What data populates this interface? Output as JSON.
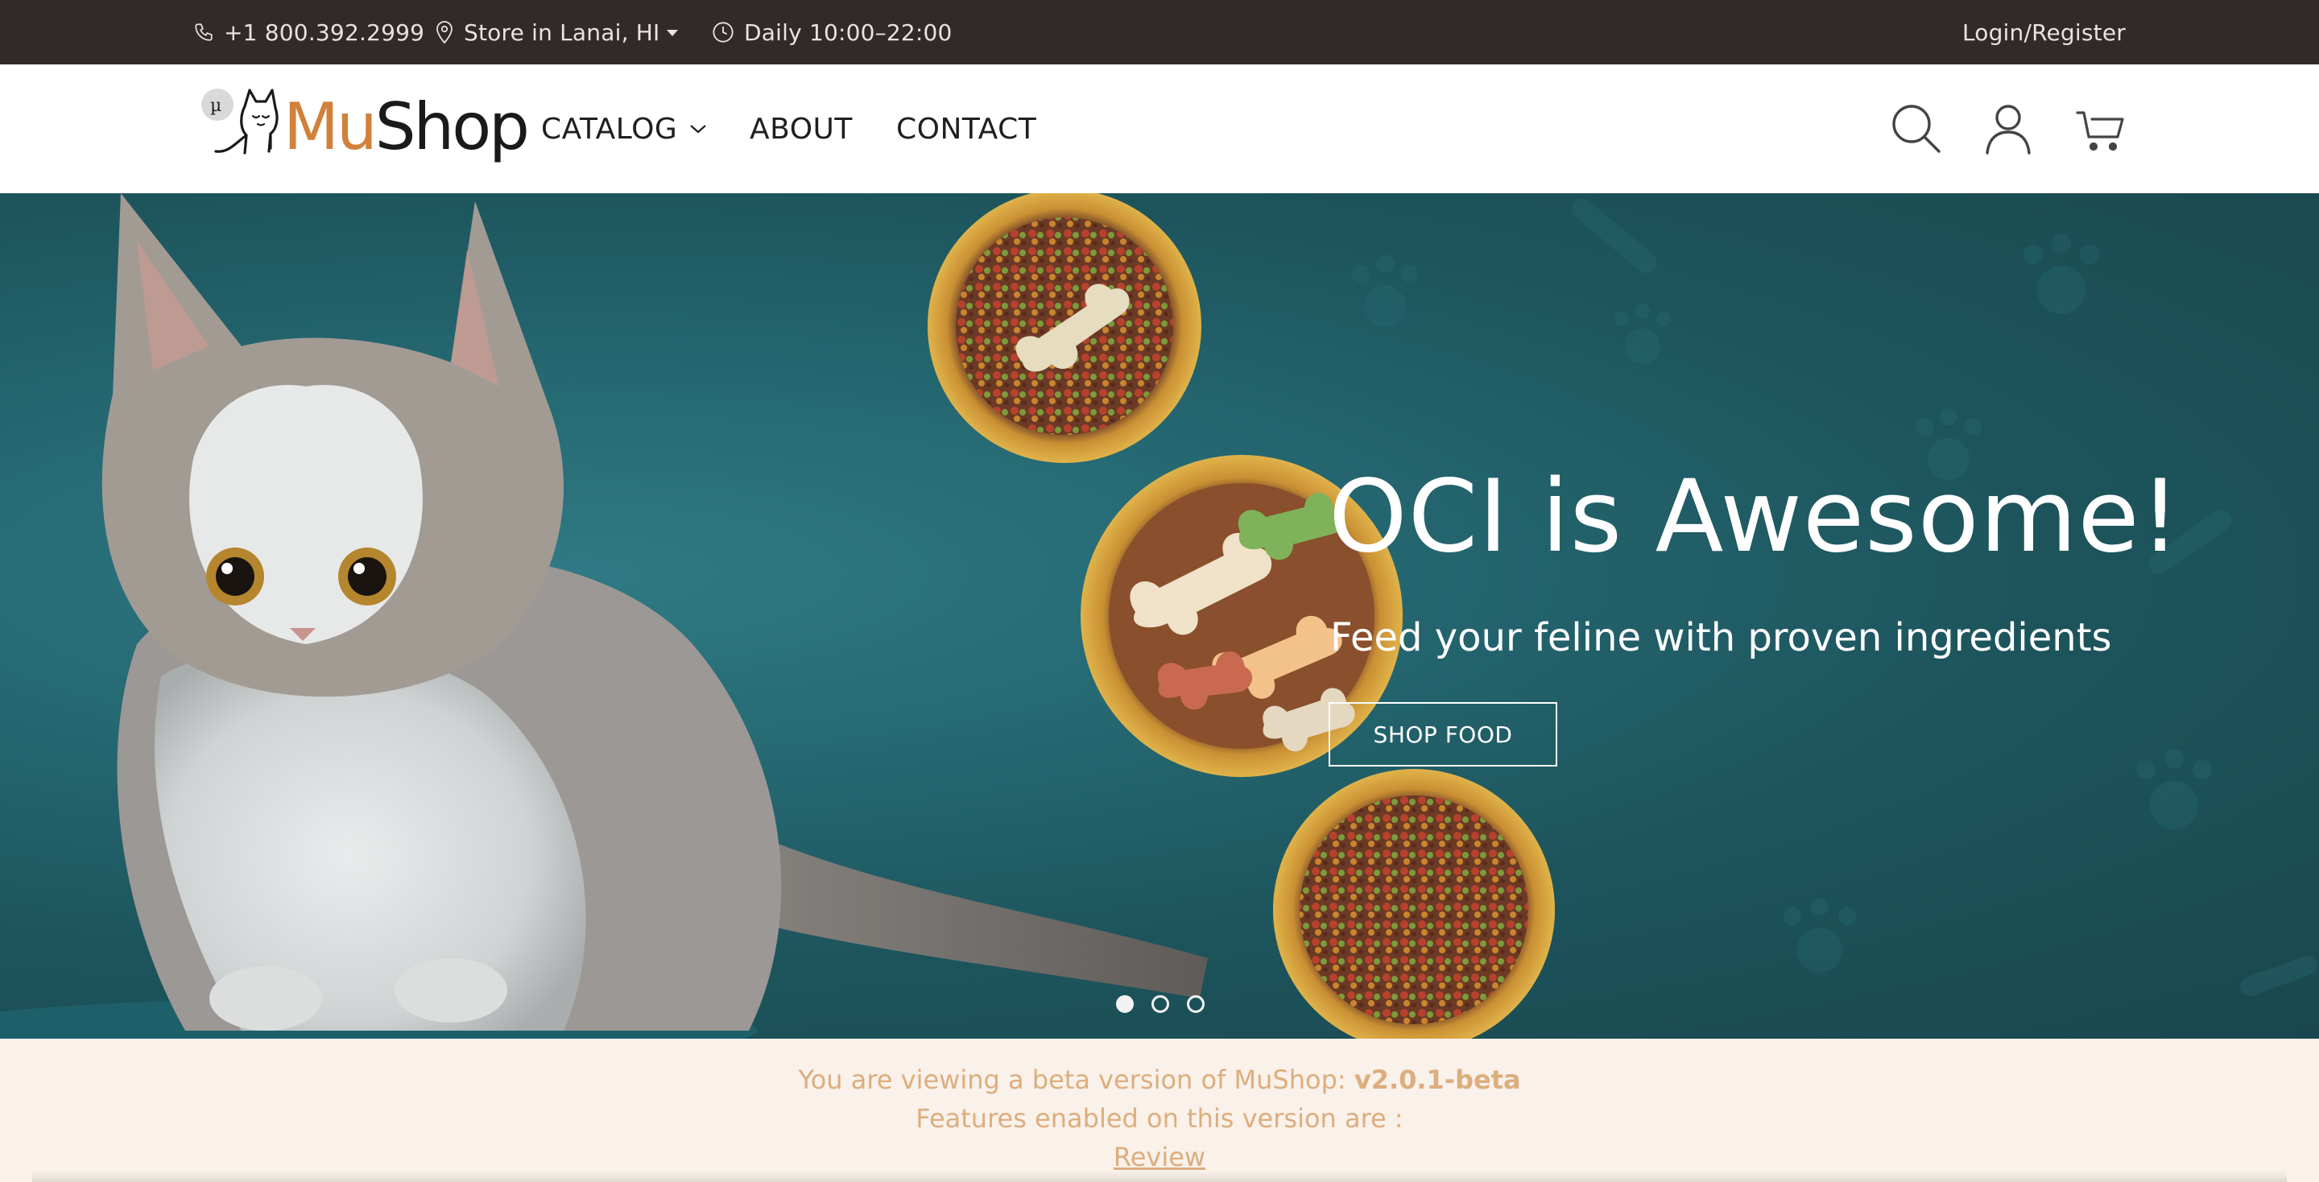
{
  "topbar": {
    "phone": "+1 800.392.2999",
    "store": "Store in Lanai, HI",
    "hours": "Daily 10:00–22:00",
    "login": "Login/Register"
  },
  "header": {
    "logo_mu": "Mu",
    "logo_shop": "Shop",
    "logo_badge": "µ",
    "nav": {
      "catalog": "CATALOG",
      "about": "ABOUT",
      "contact": "CONTACT"
    }
  },
  "hero": {
    "headline": "OCI is Awesome!",
    "subline": "Feed your feline with proven ingredients",
    "cta": "SHOP FOOD",
    "slides": 3,
    "active_slide": 1
  },
  "beta": {
    "line1_prefix": "You are viewing a beta version of MuShop: ",
    "version": "v2.0.1-beta",
    "line2": "Features enabled on this version are :",
    "feature_link": "Review"
  },
  "colors": {
    "topbar_bg": "#302b28",
    "hero_bg": "#1b4b52",
    "brand_orange": "#d2803a",
    "beta_text": "#dcae7e",
    "beta_bg": "#f9f1ea"
  },
  "icons": [
    "phone-icon",
    "location-pin-icon",
    "clock-icon",
    "chevron-down-icon",
    "search-icon",
    "user-icon",
    "cart-icon"
  ]
}
